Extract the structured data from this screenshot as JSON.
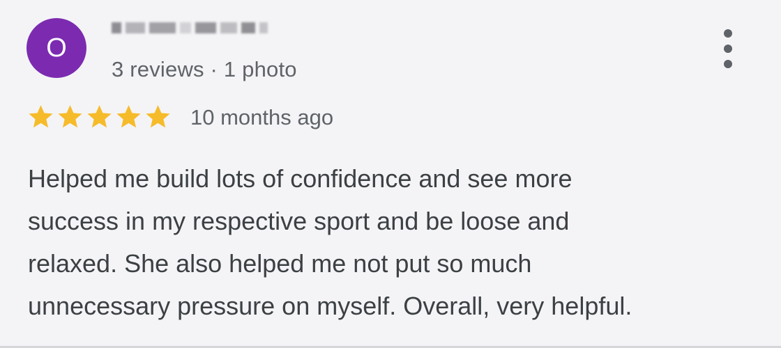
{
  "review": {
    "avatar_initial": "O",
    "avatar_color": "#7c2bb0",
    "reviewer_meta": "3 reviews · 1 photo",
    "more_options_icon": "more-vertical-icon",
    "rating": 5,
    "rating_max": 5,
    "star_color": "#f6bb2a",
    "time_ago": "10 months ago",
    "text": "Helped me build lots of confidence and see more\nsuccess in my respective sport and be loose and\nrelaxed. She also helped me not put so much\nunnecessary pressure on myself. Overall, very helpful."
  }
}
